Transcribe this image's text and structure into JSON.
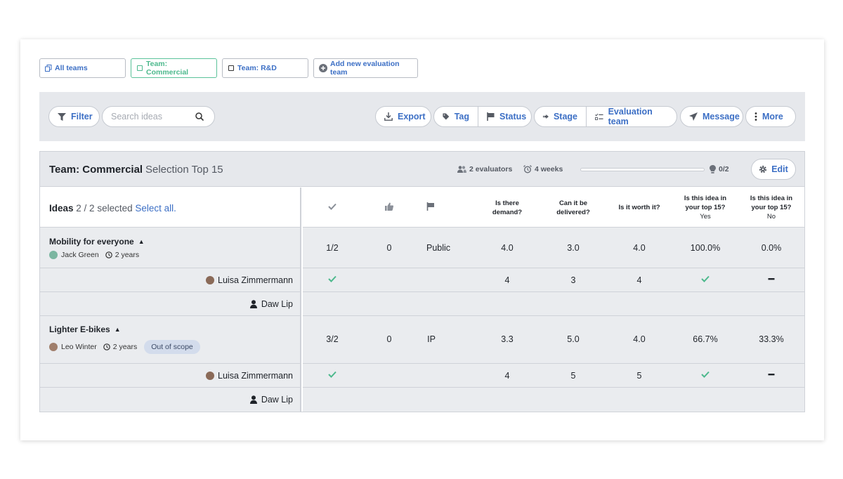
{
  "tabs": [
    {
      "label": "All teams",
      "icon": "copy-icon"
    },
    {
      "label": "Team: Commercial",
      "icon": "checkbox-icon",
      "active": true
    },
    {
      "label": "Team: R&D",
      "icon": "checkbox-icon"
    },
    {
      "label": "Add new evaluation team",
      "icon": "plus-circle-icon"
    }
  ],
  "toolbar": {
    "filter_label": "Filter",
    "search_placeholder": "Search ideas",
    "export_label": "Export",
    "tag_label": "Tag",
    "status_label": "Status",
    "stage_label": "Stage",
    "evaluation_team_label": "Evaluation team",
    "message_label": "Message",
    "more_label": "More"
  },
  "panel": {
    "title": "Team: Commercial",
    "subtitle": "Selection Top 15",
    "evaluators": "2 evaluators",
    "duration": "4 weeks",
    "progress_fraction": 0.0,
    "progress_count": "0/2",
    "edit_label": "Edit"
  },
  "table": {
    "ideas_label": "Ideas",
    "selected_text": "2 / 2 selected",
    "select_all_label": "Select all.",
    "col_demand": "Is there demand?",
    "col_delivered": "Can it be delivered?",
    "col_worth": "Is it worth it?",
    "col_top_yes": "Is this idea in your top 15?",
    "col_top_yes_sub": "Yes",
    "col_top_no": "Is this idea in your top 15?",
    "col_top_no_sub": "No",
    "ideas": [
      {
        "title": "Mobility for everyone",
        "author": "Jack Green",
        "age": "2 years",
        "badge": "",
        "done": "1/2",
        "likes": "0",
        "status": "Public",
        "demand": "4.0",
        "delivered": "3.0",
        "worth": "4.0",
        "yes": "100.0%",
        "no": "0.0%",
        "evaluations": [
          {
            "name": "Luisa Zimmermann",
            "done": true,
            "demand": "4",
            "delivered": "3",
            "worth": "4",
            "top": "yes"
          },
          {
            "name": "Daw Lip",
            "done": false,
            "demand": "",
            "delivered": "",
            "worth": "",
            "top": ""
          }
        ]
      },
      {
        "title": "Lighter E-bikes",
        "author": "Leo Winter",
        "age": "2 years",
        "badge": "Out of scope",
        "done": "3/2",
        "likes": "0",
        "status": "IP",
        "demand": "3.3",
        "delivered": "5.0",
        "worth": "4.0",
        "yes": "66.7%",
        "no": "33.3%",
        "evaluations": [
          {
            "name": "Luisa Zimmermann",
            "done": true,
            "demand": "4",
            "delivered": "5",
            "worth": "5",
            "top": "yes"
          },
          {
            "name": "Daw Lip",
            "done": false,
            "demand": "",
            "delivered": "",
            "worth": "",
            "top": ""
          }
        ]
      }
    ]
  },
  "colors": {
    "accent": "#3c6fc5",
    "green": "#4db98d",
    "panel_grey": "#e6e8ec"
  }
}
